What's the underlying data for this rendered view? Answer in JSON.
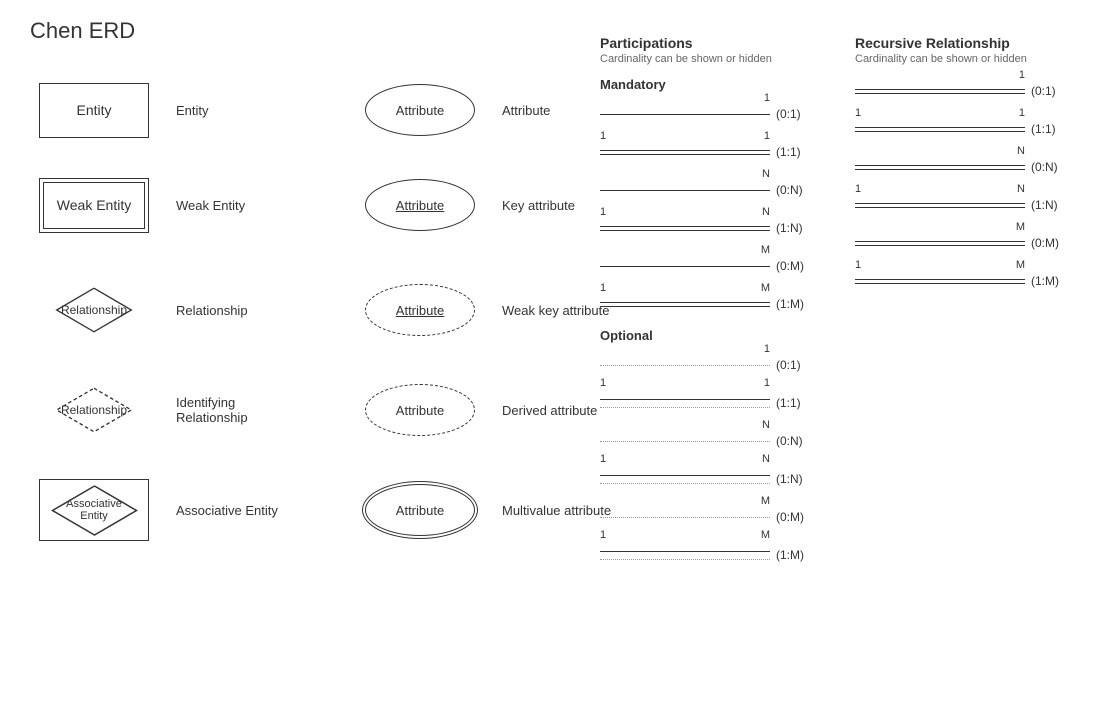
{
  "title": "Chen ERD",
  "shapes": {
    "entity": {
      "label": "Entity",
      "desc": "Entity"
    },
    "weak_entity": {
      "label": "Weak Entity",
      "desc": "Weak Entity"
    },
    "relationship": {
      "label": "Relationship",
      "desc": "Relationship"
    },
    "identifying_relationship": {
      "label": "Relationship",
      "desc": "Identifying Relationship"
    },
    "associative_entity": {
      "label": "Associative Entity",
      "desc": "Associative Entity"
    },
    "attribute": {
      "label": "Attribute",
      "desc": "Attribute"
    },
    "key_attribute": {
      "label": "Attribute",
      "desc": "Key attribute"
    },
    "weak_key_attribute": {
      "label": "Attribute",
      "desc": "Weak key attribute"
    },
    "derived_attribute": {
      "label": "Attribute",
      "desc": "Derived attribute"
    },
    "multivalue_attribute": {
      "label": "Attribute",
      "desc": "Multivalue attribute"
    }
  },
  "participations": {
    "title": "Participations",
    "subtitle": "Cardinality can be shown or hidden",
    "mandatory_label": "Mandatory",
    "optional_label": "Optional",
    "rows_mandatory": [
      {
        "left": "",
        "right": "1",
        "cardinality": "(0:1)"
      },
      {
        "left": "1",
        "right": "1",
        "cardinality": "(1:1)"
      },
      {
        "left": "",
        "right": "N",
        "cardinality": "(0:N)"
      },
      {
        "left": "1",
        "right": "N",
        "cardinality": "(1:N)"
      },
      {
        "left": "",
        "right": "M",
        "cardinality": "(0:M)"
      },
      {
        "left": "1",
        "right": "M",
        "cardinality": "(1:M)"
      }
    ],
    "rows_optional": [
      {
        "left": "",
        "right": "1",
        "cardinality": "(0:1)"
      },
      {
        "left": "1",
        "right": "1",
        "cardinality": "(1:1)"
      },
      {
        "left": "",
        "right": "N",
        "cardinality": "(0:N)"
      },
      {
        "left": "1",
        "right": "N",
        "cardinality": "(1:N)"
      },
      {
        "left": "",
        "right": "M",
        "cardinality": "(0:M)"
      },
      {
        "left": "1",
        "right": "M",
        "cardinality": "(1:M)"
      }
    ]
  },
  "recursive": {
    "title": "Recursive Relationship",
    "subtitle": "Cardinality can be shown or hidden",
    "rows": [
      {
        "left": "",
        "right": "1",
        "cardinality": "(0:1)"
      },
      {
        "left": "1",
        "right": "1",
        "cardinality": "(1:1)"
      },
      {
        "left": "",
        "right": "N",
        "cardinality": "(0:N)"
      },
      {
        "left": "1",
        "right": "N",
        "cardinality": "(1:N)"
      },
      {
        "left": "",
        "right": "M",
        "cardinality": "(0:M)"
      },
      {
        "left": "1",
        "right": "M",
        "cardinality": "(1:M)"
      }
    ]
  }
}
